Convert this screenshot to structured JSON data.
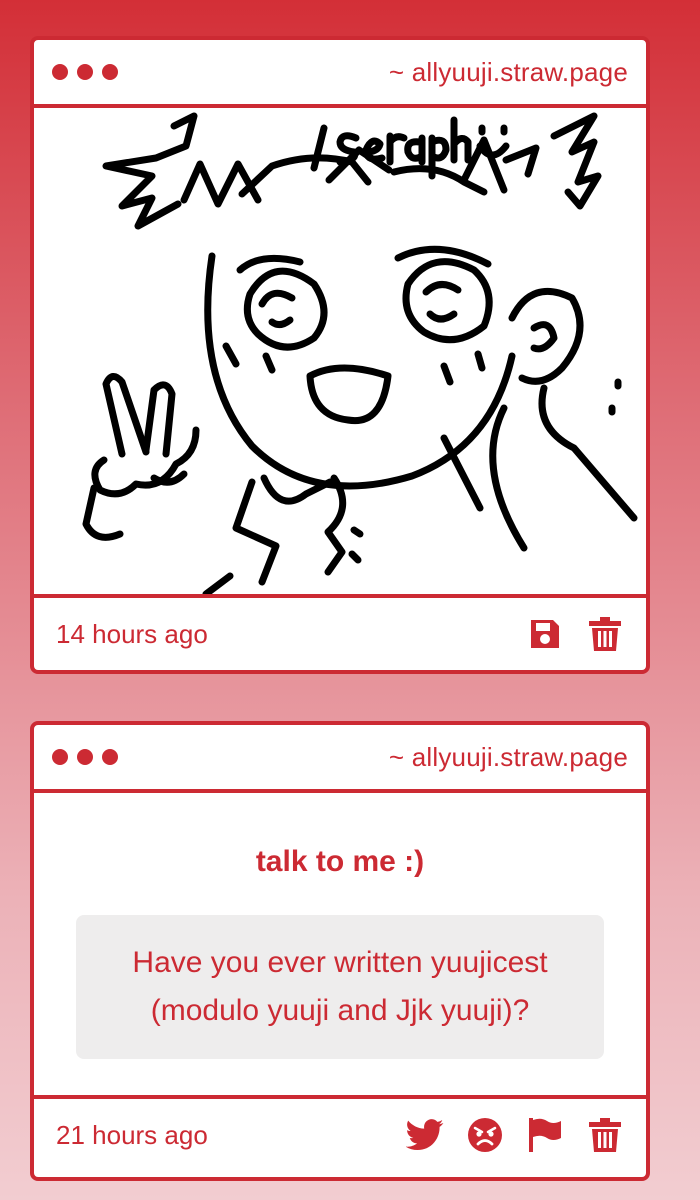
{
  "colors": {
    "accent": "#cc2a33",
    "card_background": "#ffffff",
    "question_box_background": "#eeeded",
    "gradient_top": "#d32f37",
    "gradient_bottom": "#f2cdd1"
  },
  "posts": [
    {
      "url": "~ allyuuji.straw.page",
      "drawing": {
        "handwritten_text": "seraph :)"
      },
      "timestamp": "14 hours ago",
      "actions": [
        {
          "icon": "save-icon"
        },
        {
          "icon": "trash-icon"
        }
      ]
    },
    {
      "url": "~ allyuuji.straw.page",
      "prompt_title": "talk to me :)",
      "question": "Have you ever written yuujicest (modulo yuuji and Jjk yuuji)?",
      "timestamp": "21 hours ago",
      "actions": [
        {
          "icon": "twitter-icon"
        },
        {
          "icon": "angry-face-icon"
        },
        {
          "icon": "flag-icon"
        },
        {
          "icon": "trash-icon"
        }
      ]
    }
  ]
}
